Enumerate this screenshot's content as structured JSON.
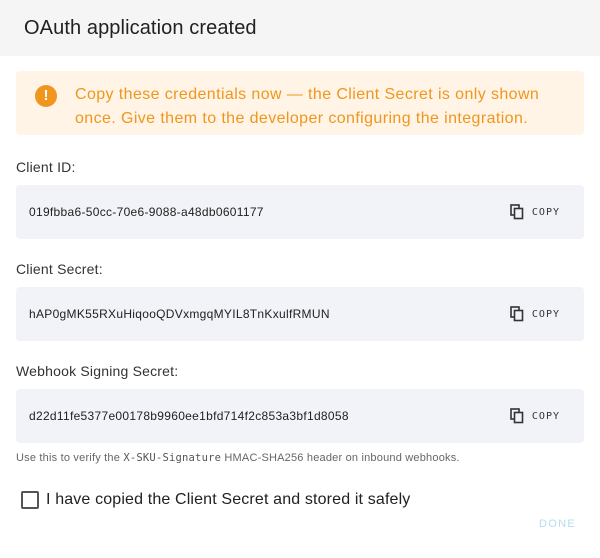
{
  "dialog": {
    "title": "OAuth application created",
    "alert": {
      "icon": "warning-circle-icon",
      "color": "#f0961e",
      "background": "#fff4e5",
      "text": "Copy these credentials now — the Client Secret is only shown once. Give them to the developer configuring the integration."
    },
    "fields": [
      {
        "label": "Client ID:",
        "value": "019fbba6-50cc-70e6-9088-a48db0601177",
        "copy_label": "COPY"
      },
      {
        "label": "Client Secret:",
        "value": "hAP0gMK55RXuHiqooQDVxmgqMYIL8TnKxulfRMUN",
        "copy_label": "COPY"
      },
      {
        "label": "Webhook Signing Secret:",
        "value": "d22d11fe5377e00178b9960ee1bfd714f2c853a3bf1d8058",
        "copy_label": "COPY"
      }
    ],
    "hint": {
      "prefix": "Use this to verify the ",
      "code": "X-SKU-Signature",
      "suffix": " HMAC-SHA256 header on inbound webhooks."
    },
    "checkbox": {
      "label": "I have copied the Client Secret and stored it safely",
      "checked": false
    },
    "done_label": "DONE",
    "done_color": "#b3ddf2"
  }
}
